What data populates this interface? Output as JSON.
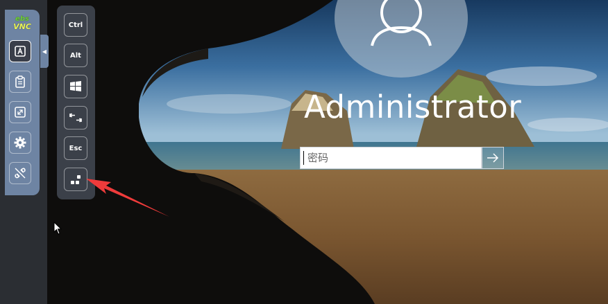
{
  "app": {
    "logo_line1": "ebs",
    "logo_line2": "VNC"
  },
  "sidebar": {
    "items": [
      {
        "name": "keyboard-icon",
        "active": true
      },
      {
        "name": "clipboard-icon",
        "active": false
      },
      {
        "name": "fullscreen-icon",
        "active": false
      },
      {
        "name": "gear-icon",
        "active": false
      },
      {
        "name": "disconnect-icon",
        "active": false
      }
    ]
  },
  "extra_keys": {
    "ctrl": "Ctrl",
    "alt": "Alt",
    "windows": "windows-icon",
    "tab": "tab-icon",
    "esc": "Esc",
    "ctrl_alt_del": "ctrl-alt-del-icon"
  },
  "login": {
    "username": "Administrator",
    "password_placeholder": "密码",
    "submit_icon": "arrow-right-icon"
  },
  "colors": {
    "sidebar": "#6e84a3",
    "keys_panel": "#3b4049",
    "annotation_arrow": "#ef3b3b"
  }
}
